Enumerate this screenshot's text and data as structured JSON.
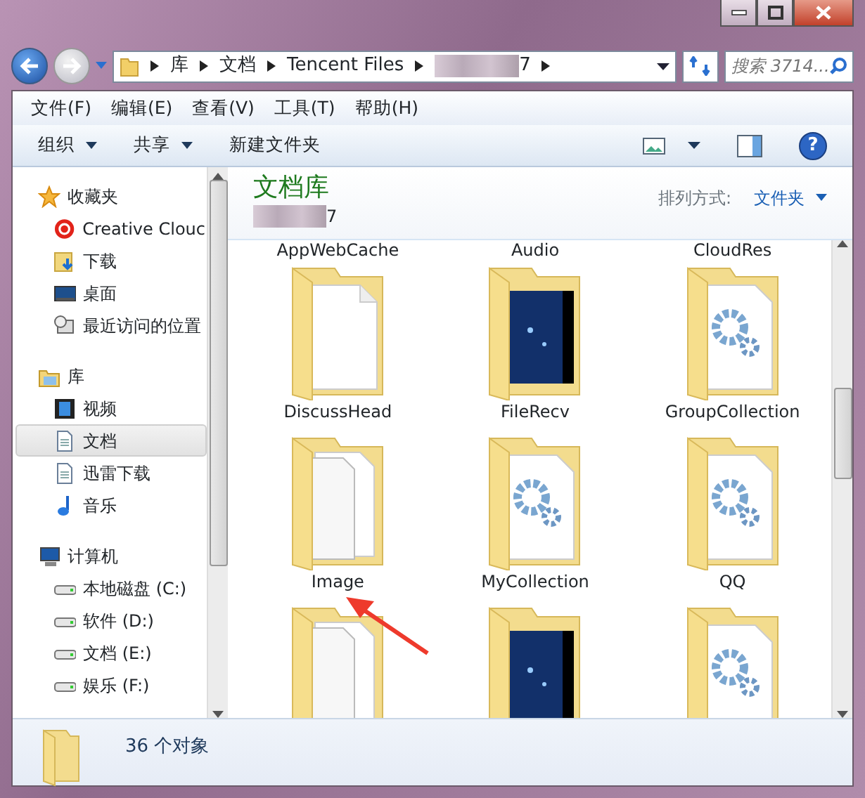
{
  "address": {
    "segments": [
      "库",
      "文档",
      "Tencent Files",
      "7"
    ],
    "search_placeholder": "搜索 3714..."
  },
  "menu": [
    "文件(F)",
    "编辑(E)",
    "查看(V)",
    "工具(T)",
    "帮助(H)"
  ],
  "help_button": "?",
  "toolbar": [
    {
      "label": "组织",
      "dropdown": true
    },
    {
      "label": "共享",
      "dropdown": true
    },
    {
      "label": "新建文件夹",
      "dropdown": false
    }
  ],
  "sidebar": [
    {
      "label": "收藏夹",
      "kind": "star",
      "children": [
        {
          "label": "Creative Clouc",
          "kind": "cloud",
          "selected": false
        },
        {
          "label": "下载",
          "kind": "download",
          "selected": false
        },
        {
          "label": "桌面",
          "kind": "desktop",
          "selected": false
        },
        {
          "label": "最近访问的位置",
          "kind": "recent",
          "selected": false
        }
      ]
    },
    {
      "label": "库",
      "kind": "library",
      "children": [
        {
          "label": "视频",
          "kind": "video",
          "selected": false
        },
        {
          "label": "文档",
          "kind": "doc",
          "selected": true
        },
        {
          "label": "迅雷下载",
          "kind": "doc",
          "selected": false
        },
        {
          "label": "音乐",
          "kind": "music",
          "selected": false
        }
      ]
    },
    {
      "label": "计算机",
      "kind": "computer",
      "children": [
        {
          "label": "本地磁盘 (C:)",
          "kind": "drive",
          "selected": false
        },
        {
          "label": "软件 (D:)",
          "kind": "drive",
          "selected": false
        },
        {
          "label": "文档 (E:)",
          "kind": "drive",
          "selected": false
        },
        {
          "label": "娱乐 (F:)",
          "kind": "drive",
          "selected": false
        }
      ]
    }
  ],
  "library": {
    "title": "文档库",
    "subtitle": "7",
    "arrange_label": "排列方式:",
    "arrange_value": "文件夹"
  },
  "files": [
    {
      "name": "AppWebCache",
      "kind": "label"
    },
    {
      "name": "Audio",
      "kind": "label"
    },
    {
      "name": "CloudRes",
      "kind": "label"
    },
    {
      "name": "DiscussHead",
      "kind": "doc"
    },
    {
      "name": "FileRecv",
      "kind": "photo"
    },
    {
      "name": "GroupCollection",
      "kind": "gear"
    },
    {
      "name": "Image",
      "kind": "docs"
    },
    {
      "name": "MyCollection",
      "kind": "gear"
    },
    {
      "name": "QQ",
      "kind": "gear"
    },
    {
      "kind": "docs"
    },
    {
      "kind": "photo"
    },
    {
      "kind": "gear"
    }
  ],
  "status": {
    "count": "36 个对象"
  }
}
